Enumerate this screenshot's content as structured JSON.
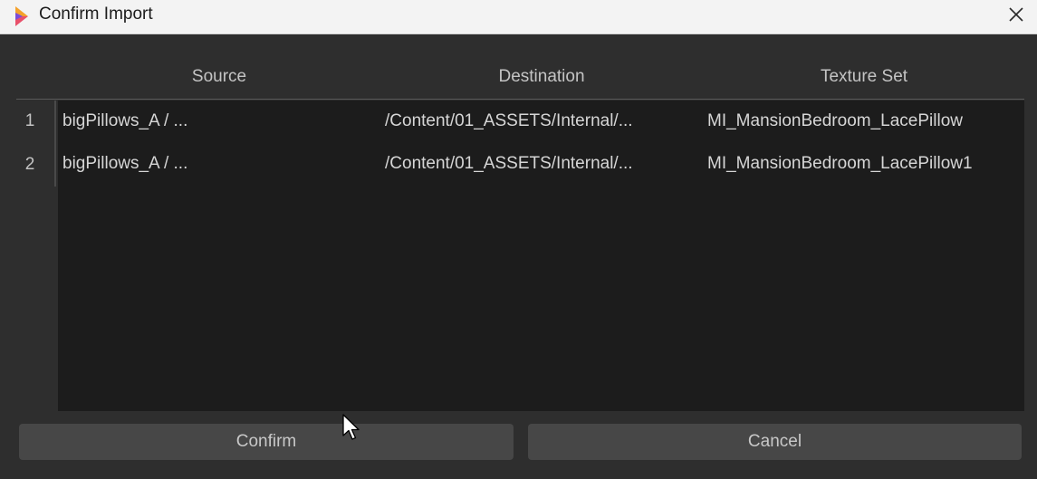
{
  "window": {
    "title": "Confirm Import",
    "icons": {
      "app": "substance-app-icon",
      "close": "close-icon",
      "cursor": "mouse-cursor-icon"
    },
    "accent_colors": [
      "#f4a12a",
      "#e8506a",
      "#7b4cd8"
    ]
  },
  "table": {
    "columns": [
      "Source",
      "Destination",
      "Texture Set"
    ],
    "rows": [
      {
        "num": "1",
        "source": "bigPillows_A / ...",
        "destination": "/Content/01_ASSETS/Internal/...",
        "texture_set": "MI_MansionBedroom_LacePillow"
      },
      {
        "num": "2",
        "source": "bigPillows_A / ...",
        "destination": "/Content/01_ASSETS/Internal/...",
        "texture_set": "MI_MansionBedroom_LacePillow1"
      }
    ]
  },
  "buttons": {
    "confirm": "Confirm",
    "cancel": "Cancel"
  }
}
